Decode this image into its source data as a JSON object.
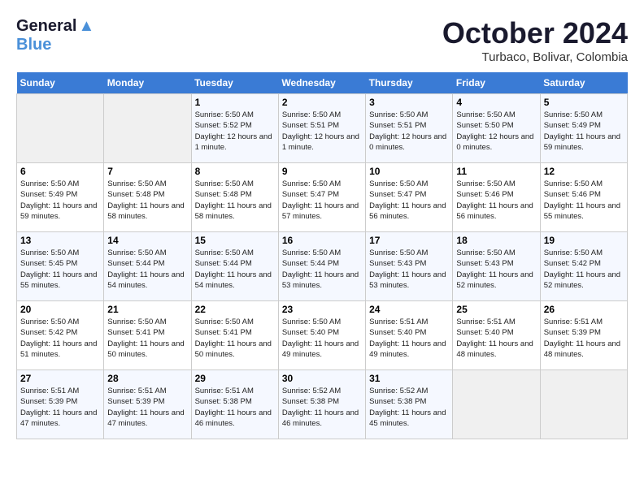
{
  "header": {
    "logo_line1": "General",
    "logo_line2": "Blue",
    "month": "October 2024",
    "location": "Turbaco, Bolivar, Colombia"
  },
  "weekdays": [
    "Sunday",
    "Monday",
    "Tuesday",
    "Wednesday",
    "Thursday",
    "Friday",
    "Saturday"
  ],
  "weeks": [
    [
      {
        "day": "",
        "sunrise": "",
        "sunset": "",
        "daylight": "",
        "empty": true
      },
      {
        "day": "",
        "sunrise": "",
        "sunset": "",
        "daylight": "",
        "empty": true
      },
      {
        "day": "1",
        "sunrise": "Sunrise: 5:50 AM",
        "sunset": "Sunset: 5:52 PM",
        "daylight": "Daylight: 12 hours and 1 minute."
      },
      {
        "day": "2",
        "sunrise": "Sunrise: 5:50 AM",
        "sunset": "Sunset: 5:51 PM",
        "daylight": "Daylight: 12 hours and 1 minute."
      },
      {
        "day": "3",
        "sunrise": "Sunrise: 5:50 AM",
        "sunset": "Sunset: 5:51 PM",
        "daylight": "Daylight: 12 hours and 0 minutes."
      },
      {
        "day": "4",
        "sunrise": "Sunrise: 5:50 AM",
        "sunset": "Sunset: 5:50 PM",
        "daylight": "Daylight: 12 hours and 0 minutes."
      },
      {
        "day": "5",
        "sunrise": "Sunrise: 5:50 AM",
        "sunset": "Sunset: 5:49 PM",
        "daylight": "Daylight: 11 hours and 59 minutes."
      }
    ],
    [
      {
        "day": "6",
        "sunrise": "Sunrise: 5:50 AM",
        "sunset": "Sunset: 5:49 PM",
        "daylight": "Daylight: 11 hours and 59 minutes."
      },
      {
        "day": "7",
        "sunrise": "Sunrise: 5:50 AM",
        "sunset": "Sunset: 5:48 PM",
        "daylight": "Daylight: 11 hours and 58 minutes."
      },
      {
        "day": "8",
        "sunrise": "Sunrise: 5:50 AM",
        "sunset": "Sunset: 5:48 PM",
        "daylight": "Daylight: 11 hours and 58 minutes."
      },
      {
        "day": "9",
        "sunrise": "Sunrise: 5:50 AM",
        "sunset": "Sunset: 5:47 PM",
        "daylight": "Daylight: 11 hours and 57 minutes."
      },
      {
        "day": "10",
        "sunrise": "Sunrise: 5:50 AM",
        "sunset": "Sunset: 5:47 PM",
        "daylight": "Daylight: 11 hours and 56 minutes."
      },
      {
        "day": "11",
        "sunrise": "Sunrise: 5:50 AM",
        "sunset": "Sunset: 5:46 PM",
        "daylight": "Daylight: 11 hours and 56 minutes."
      },
      {
        "day": "12",
        "sunrise": "Sunrise: 5:50 AM",
        "sunset": "Sunset: 5:46 PM",
        "daylight": "Daylight: 11 hours and 55 minutes."
      }
    ],
    [
      {
        "day": "13",
        "sunrise": "Sunrise: 5:50 AM",
        "sunset": "Sunset: 5:45 PM",
        "daylight": "Daylight: 11 hours and 55 minutes."
      },
      {
        "day": "14",
        "sunrise": "Sunrise: 5:50 AM",
        "sunset": "Sunset: 5:44 PM",
        "daylight": "Daylight: 11 hours and 54 minutes."
      },
      {
        "day": "15",
        "sunrise": "Sunrise: 5:50 AM",
        "sunset": "Sunset: 5:44 PM",
        "daylight": "Daylight: 11 hours and 54 minutes."
      },
      {
        "day": "16",
        "sunrise": "Sunrise: 5:50 AM",
        "sunset": "Sunset: 5:44 PM",
        "daylight": "Daylight: 11 hours and 53 minutes."
      },
      {
        "day": "17",
        "sunrise": "Sunrise: 5:50 AM",
        "sunset": "Sunset: 5:43 PM",
        "daylight": "Daylight: 11 hours and 53 minutes."
      },
      {
        "day": "18",
        "sunrise": "Sunrise: 5:50 AM",
        "sunset": "Sunset: 5:43 PM",
        "daylight": "Daylight: 11 hours and 52 minutes."
      },
      {
        "day": "19",
        "sunrise": "Sunrise: 5:50 AM",
        "sunset": "Sunset: 5:42 PM",
        "daylight": "Daylight: 11 hours and 52 minutes."
      }
    ],
    [
      {
        "day": "20",
        "sunrise": "Sunrise: 5:50 AM",
        "sunset": "Sunset: 5:42 PM",
        "daylight": "Daylight: 11 hours and 51 minutes."
      },
      {
        "day": "21",
        "sunrise": "Sunrise: 5:50 AM",
        "sunset": "Sunset: 5:41 PM",
        "daylight": "Daylight: 11 hours and 50 minutes."
      },
      {
        "day": "22",
        "sunrise": "Sunrise: 5:50 AM",
        "sunset": "Sunset: 5:41 PM",
        "daylight": "Daylight: 11 hours and 50 minutes."
      },
      {
        "day": "23",
        "sunrise": "Sunrise: 5:50 AM",
        "sunset": "Sunset: 5:40 PM",
        "daylight": "Daylight: 11 hours and 49 minutes."
      },
      {
        "day": "24",
        "sunrise": "Sunrise: 5:51 AM",
        "sunset": "Sunset: 5:40 PM",
        "daylight": "Daylight: 11 hours and 49 minutes."
      },
      {
        "day": "25",
        "sunrise": "Sunrise: 5:51 AM",
        "sunset": "Sunset: 5:40 PM",
        "daylight": "Daylight: 11 hours and 48 minutes."
      },
      {
        "day": "26",
        "sunrise": "Sunrise: 5:51 AM",
        "sunset": "Sunset: 5:39 PM",
        "daylight": "Daylight: 11 hours and 48 minutes."
      }
    ],
    [
      {
        "day": "27",
        "sunrise": "Sunrise: 5:51 AM",
        "sunset": "Sunset: 5:39 PM",
        "daylight": "Daylight: 11 hours and 47 minutes."
      },
      {
        "day": "28",
        "sunrise": "Sunrise: 5:51 AM",
        "sunset": "Sunset: 5:39 PM",
        "daylight": "Daylight: 11 hours and 47 minutes."
      },
      {
        "day": "29",
        "sunrise": "Sunrise: 5:51 AM",
        "sunset": "Sunset: 5:38 PM",
        "daylight": "Daylight: 11 hours and 46 minutes."
      },
      {
        "day": "30",
        "sunrise": "Sunrise: 5:52 AM",
        "sunset": "Sunset: 5:38 PM",
        "daylight": "Daylight: 11 hours and 46 minutes."
      },
      {
        "day": "31",
        "sunrise": "Sunrise: 5:52 AM",
        "sunset": "Sunset: 5:38 PM",
        "daylight": "Daylight: 11 hours and 45 minutes."
      },
      {
        "day": "",
        "sunrise": "",
        "sunset": "",
        "daylight": "",
        "empty": true
      },
      {
        "day": "",
        "sunrise": "",
        "sunset": "",
        "daylight": "",
        "empty": true
      }
    ]
  ]
}
